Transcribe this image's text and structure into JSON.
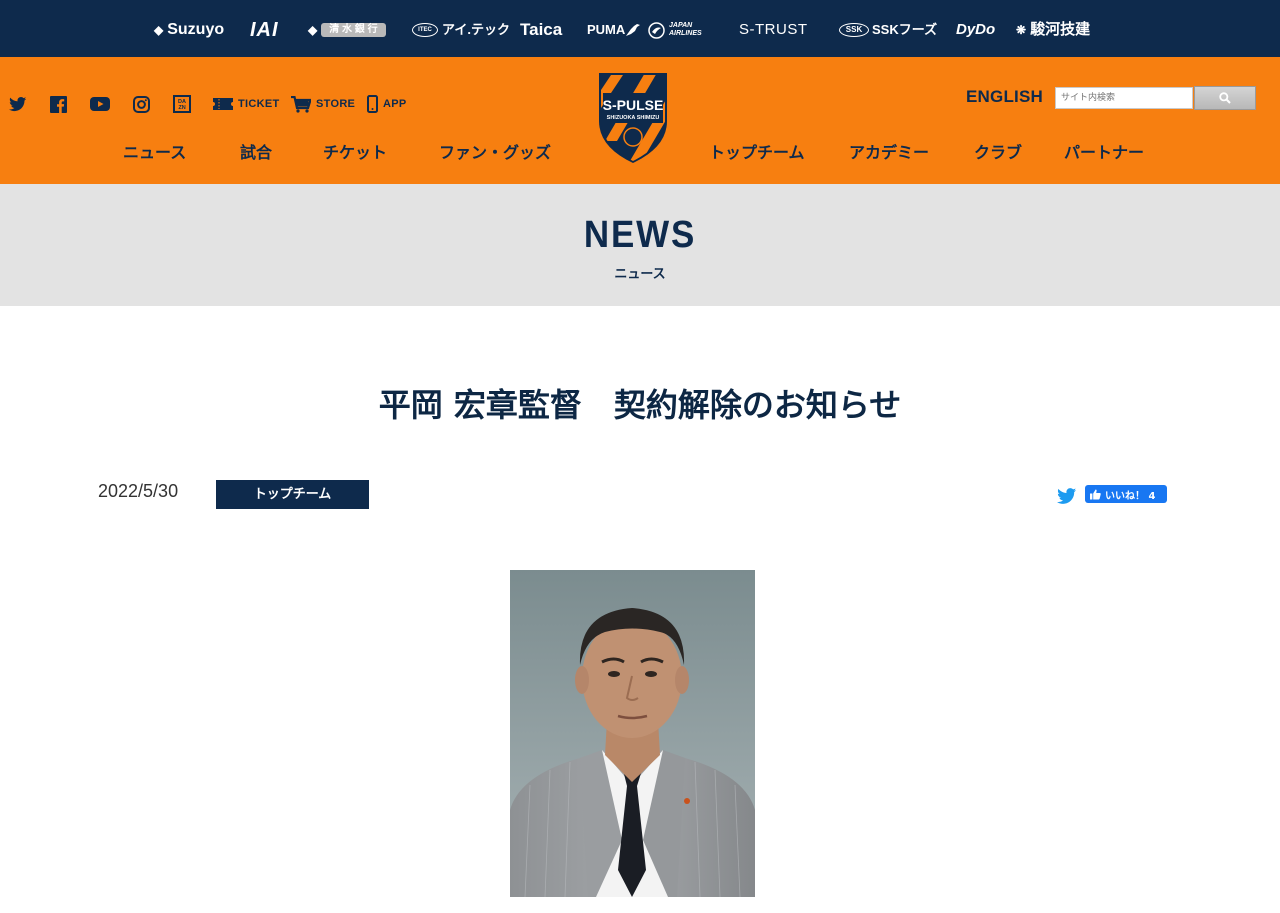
{
  "sponsors": [
    {
      "name": "Suzuyo",
      "icon": "suzuyo-diamond-icon"
    },
    {
      "name": "IAI"
    },
    {
      "name": "清 水 銀 行",
      "icon": "shimizu-bank-icon"
    },
    {
      "name": "アイ.テック",
      "icon": "itec-icon"
    },
    {
      "name": "Taica"
    },
    {
      "name": "PUMA",
      "icon": "puma-cat-icon"
    },
    {
      "name": "JAPAN AIRLINES",
      "icon": "jal-crane-icon"
    },
    {
      "name": "S-TRUST"
    },
    {
      "name": "SSKフーズ",
      "icon": "ssk-icon"
    },
    {
      "name": "DyDo"
    },
    {
      "name": "駿河技建",
      "icon": "surugagiken-icon"
    }
  ],
  "header": {
    "social": {
      "twitter_icon": "twitter-icon",
      "facebook_icon": "facebook-icon",
      "youtube_icon": "youtube-icon",
      "instagram_icon": "instagram-icon",
      "dazn_icon": "dazn-icon",
      "ticket_label": "TICKET",
      "store_label": "STORE",
      "app_label": "APP"
    },
    "nav_left": [
      "ニュース",
      "試合",
      "チケット",
      "ファン・グッズ"
    ],
    "nav_right": [
      "トップチーム",
      "アカデミー",
      "クラブ",
      "パートナー"
    ],
    "english_label": "ENGLISH",
    "search_placeholder": "サイト内検索",
    "logo": {
      "text_main": "S-PULSE",
      "text_sub": "SHIZUOKA SHIMIZU"
    }
  },
  "section": {
    "title": "NEWS",
    "subtitle": "ニュース"
  },
  "article": {
    "title": "平岡 宏章監督　契約解除のお知らせ",
    "date": "2022/5/30",
    "category": "トップチーム",
    "fb_like_label": "いいね！ 4"
  },
  "colors": {
    "navy": "#0e2a4c",
    "orange": "#f77f10",
    "band_grey": "#e3e3e3",
    "fb_blue": "#1877f2",
    "twitter_blue": "#1d9bf0"
  }
}
